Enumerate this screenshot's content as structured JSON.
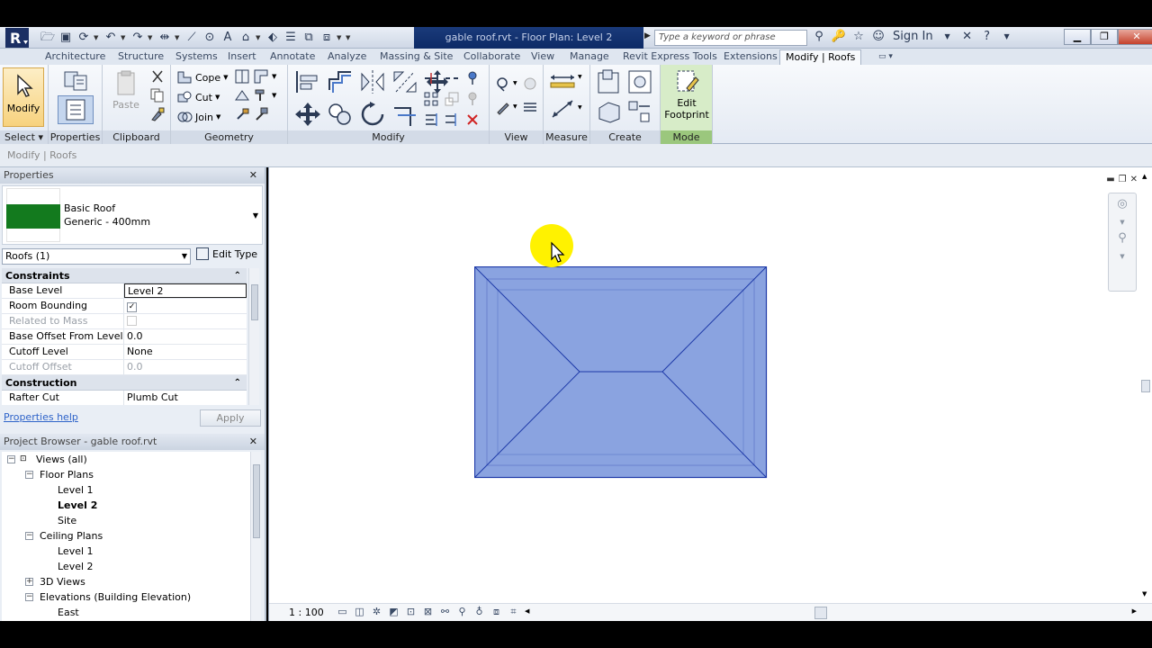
{
  "app": {
    "document_title": "gable roof.rvt - Floor Plan: Level 2",
    "search_placeholder": "Type a keyword or phrase",
    "sign_in": "Sign In"
  },
  "tabs": [
    {
      "label": "Architecture",
      "active": false
    },
    {
      "label": "Structure",
      "active": false
    },
    {
      "label": "Systems",
      "active": false
    },
    {
      "label": "Insert",
      "active": false
    },
    {
      "label": "Annotate",
      "active": false
    },
    {
      "label": "Analyze",
      "active": false
    },
    {
      "label": "Massing & Site",
      "active": false
    },
    {
      "label": "Collaborate",
      "active": false
    },
    {
      "label": "View",
      "active": false
    },
    {
      "label": "Manage",
      "active": false
    },
    {
      "label": "Revit Express Tools",
      "active": false
    },
    {
      "label": "Extensions",
      "active": false
    },
    {
      "label": "Modify | Roofs",
      "active": true
    }
  ],
  "ribbon": {
    "select": {
      "button": "Modify",
      "label": "Select"
    },
    "properties": {
      "label": "Properties"
    },
    "clipboard": {
      "paste": "Paste",
      "label": "Clipboard"
    },
    "geometry": {
      "cope": "Cope",
      "cut": "Cut",
      "join": "Join",
      "label": "Geometry"
    },
    "modify": {
      "label": "Modify"
    },
    "view": {
      "label": "View"
    },
    "measure": {
      "label": "Measure"
    },
    "create": {
      "label": "Create"
    },
    "mode": {
      "button_line1": "Edit",
      "button_line2": "Footprint",
      "label": "Mode"
    }
  },
  "options_bar": {
    "context": "Modify | Roofs"
  },
  "properties_palette": {
    "title": "Properties",
    "type_family": "Basic Roof",
    "type_name": "Generic - 400mm",
    "swatch_color": "#137a1e",
    "instance_selector": "Roofs (1)",
    "edit_type": "Edit Type",
    "groups": [
      {
        "name": "Constraints",
        "rows": [
          {
            "name": "Base Level",
            "value": "Level 2",
            "dim": false
          },
          {
            "name": "Room Bounding",
            "value": "✓",
            "dim": false
          },
          {
            "name": "Related to Mass",
            "value": "",
            "dim": true
          },
          {
            "name": "Base Offset From Level",
            "value": "0.0",
            "dim": false
          },
          {
            "name": "Cutoff Level",
            "value": "None",
            "dim": false
          },
          {
            "name": "Cutoff Offset",
            "value": "0.0",
            "dim": true
          }
        ]
      },
      {
        "name": "Construction",
        "rows": [
          {
            "name": "Rafter Cut",
            "value": "Plumb Cut",
            "dim": false
          }
        ]
      }
    ],
    "help_link": "Properties help",
    "apply": "Apply"
  },
  "project_browser": {
    "title": "Project Browser - gable roof.rvt",
    "nodes": [
      {
        "label": "Views (all)",
        "level": 0,
        "expander": "−",
        "bold": false
      },
      {
        "label": "Floor Plans",
        "level": 1,
        "expander": "−",
        "bold": false
      },
      {
        "label": "Level 1",
        "level": 2,
        "expander": "",
        "bold": false
      },
      {
        "label": "Level 2",
        "level": 2,
        "expander": "",
        "bold": true
      },
      {
        "label": "Site",
        "level": 2,
        "expander": "",
        "bold": false
      },
      {
        "label": "Ceiling Plans",
        "level": 1,
        "expander": "−",
        "bold": false
      },
      {
        "label": "Level 1",
        "level": 2,
        "expander": "",
        "bold": false
      },
      {
        "label": "Level 2",
        "level": 2,
        "expander": "",
        "bold": false
      },
      {
        "label": "3D Views",
        "level": 1,
        "expander": "+",
        "bold": false
      },
      {
        "label": "Elevations (Building Elevation)",
        "level": 1,
        "expander": "−",
        "bold": false
      },
      {
        "label": "East",
        "level": 2,
        "expander": "",
        "bold": false
      }
    ]
  },
  "view": {
    "scale": "1 : 100",
    "roof_fill": "#8aa3e0",
    "roof_stroke": "#1e3aa8",
    "highlight": "#fff200"
  }
}
